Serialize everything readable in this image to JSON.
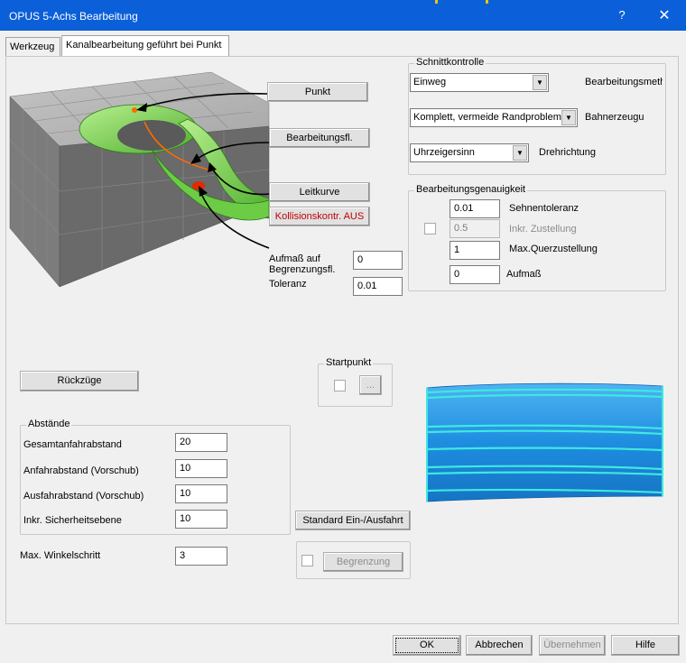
{
  "window": {
    "title": "OPUS 5-Achs Bearbeitung",
    "help_glyph": "?",
    "close_glyph": "✕"
  },
  "tabs": [
    {
      "label": "Werkzeug"
    },
    {
      "label": "Kanalbearbeitung geführt bei Punkt"
    }
  ],
  "diagram_buttons": {
    "punkt": "Punkt",
    "bearbeitungsfl": "Bearbeitungsfl.",
    "leitkurve": "Leitkurve",
    "kollision": "Kollisionskontr. AUS"
  },
  "aufmass": {
    "label": "Aufmaß auf Begrenzungsfl.",
    "value": "0"
  },
  "toleranz": {
    "label": "Toleranz",
    "value": "0.01"
  },
  "schnittkontrolle": {
    "legend": "Schnittkontrolle",
    "methode": {
      "value": "Einweg",
      "label": "Bearbeitungsmeth"
    },
    "bahnen": {
      "value": "Komplett, vermeide Randprobleme",
      "label": "Bahnerzeugu"
    },
    "dreh": {
      "value": "Uhrzeigersinn",
      "label": "Drehrichtung"
    }
  },
  "genauigkeit": {
    "legend": "Bearbeitungsgenauigkeit",
    "sehnentoleranz": {
      "value": "0.01",
      "label": "Sehnentoleranz"
    },
    "inkr_zustellung": {
      "value": "0.5",
      "label": "Inkr. Zustellung"
    },
    "max_quer": {
      "value": "1",
      "label": "Max.Querzustellung"
    },
    "aufmass": {
      "value": "0",
      "label": "Aufmaß"
    }
  },
  "rueckzuege_label": "Rückzüge",
  "startpunkt": {
    "legend": "Startpunkt",
    "browse_label": "..."
  },
  "abstaende": {
    "legend": "Abstände",
    "rows": [
      {
        "label": "Gesamtanfahrabstand",
        "value": "20"
      },
      {
        "label": "Anfahrabstand (Vorschub)",
        "value": "10"
      },
      {
        "label": "Ausfahrabstand (Vorschub)",
        "value": "10"
      },
      {
        "label": "Inkr. Sicherheitsebene",
        "value": "10"
      }
    ]
  },
  "standard_ein_aus": "Standard Ein-/Ausfahrt",
  "winkelschritt": {
    "label": "Max. Winkelschritt",
    "value": "3"
  },
  "begrenzung_label": "Begrenzung",
  "footer": {
    "ok": "OK",
    "cancel": "Abbrechen",
    "apply": "Übernehmen",
    "help": "Hilfe"
  },
  "colors": {
    "title_bar": "#0b5fd9",
    "kollision_text": "#c00000",
    "surface_blue": "#1e90e6",
    "path_cyan": "#3ee8e0",
    "model_green": "#7dda5a"
  }
}
